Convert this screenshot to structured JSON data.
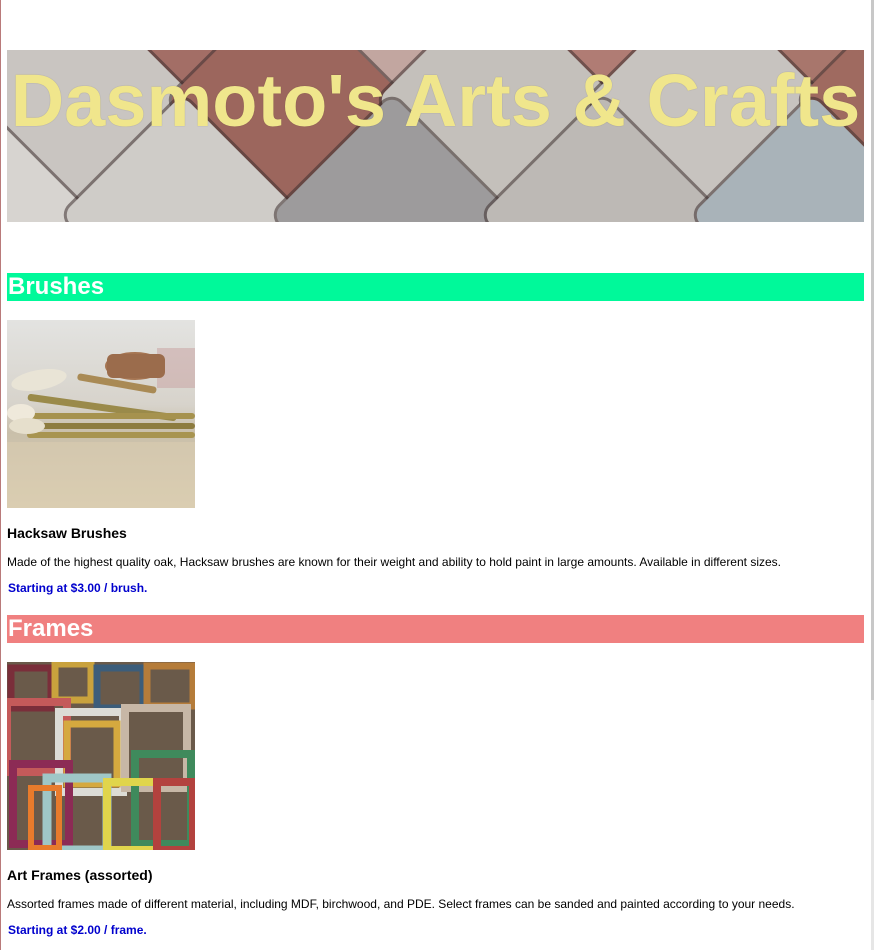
{
  "header": {
    "title": "Dasmoto's Arts & Crafts",
    "title_color": "#f0e68c"
  },
  "sections": {
    "brushes": {
      "heading": "Brushes",
      "heading_bg": "#00f99a",
      "image_alt": "Hacksaw Brushes",
      "product_name": "Hacksaw Brushes",
      "description": "Made of the highest quality oak, Hacksaw brushes are known for their weight and ability to hold paint in large amounts. Available in different sizes.",
      "price": "Starting at $3.00 / brush."
    },
    "frames": {
      "heading": "Frames",
      "heading_bg": "#f08080",
      "image_alt": "Art Frames (assorted)",
      "product_name": "Art Frames (assorted)",
      "description": "Assorted frames made of different material, including MDF, birchwood, and PDE. Select frames can be sanded and painted according to your needs.",
      "price": "Starting at $2.00 / frame."
    }
  },
  "colors": {
    "price_text": "#0000cd",
    "heading_text": "#ffffff"
  }
}
